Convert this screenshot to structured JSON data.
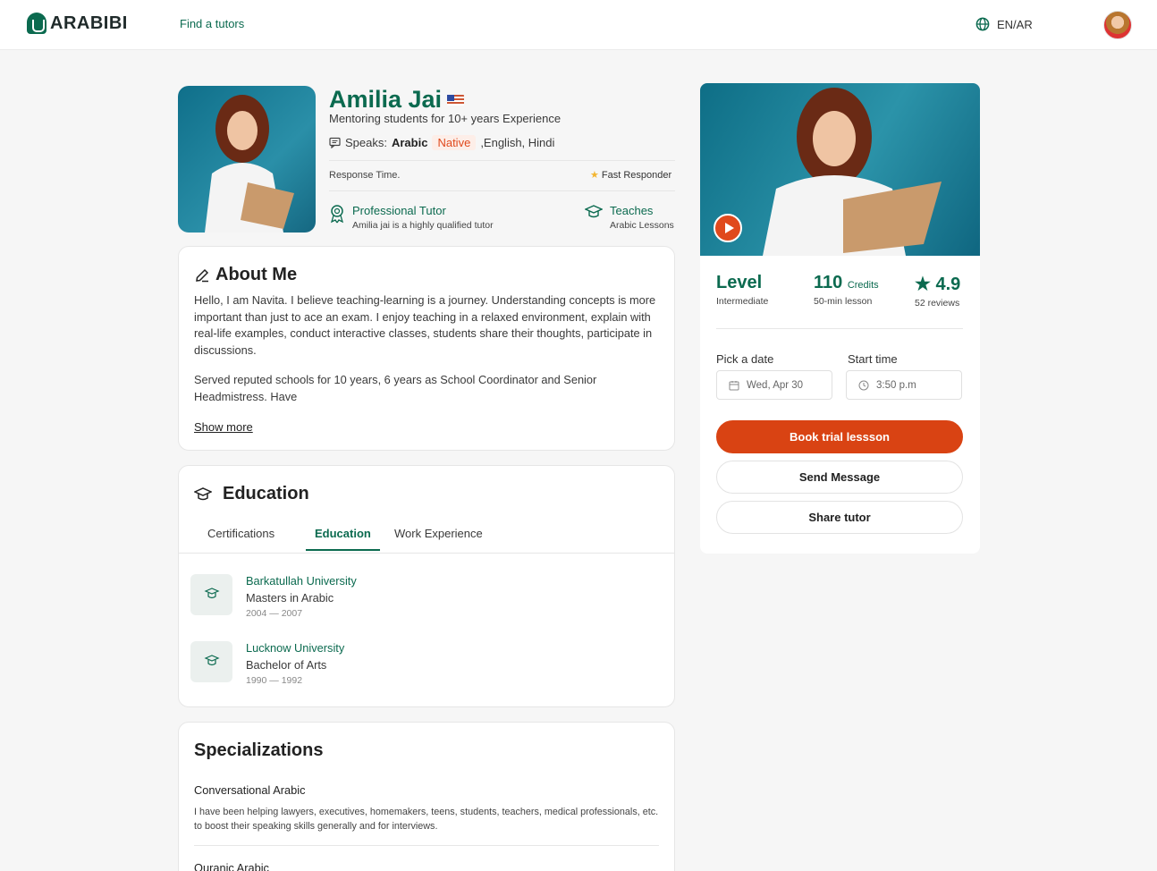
{
  "header": {
    "logo_text": "ARABIBI",
    "nav_link": "Find a tutors",
    "language": "EN/AR"
  },
  "profile": {
    "name": "Amilia Jai",
    "subtitle": "Mentoring students for 10+  years Experience",
    "speaks_label": "Speaks:",
    "speaks_primary": "Arabic",
    "native_badge": "Native",
    "speaks_others": ",English, Hindi",
    "response_label": "Response Time.",
    "fast_responder": "Fast Responder",
    "features": [
      {
        "title": "Professional Tutor",
        "desc": "Amilia jai is a highly qualified tutor"
      },
      {
        "title": "Teaches",
        "desc": "Arabic Lessons"
      }
    ]
  },
  "about": {
    "title": "About Me",
    "p1": "Hello, I am Navita. I believe teaching-learning is a journey. Understanding concepts is more important than just to ace an exam. I enjoy teaching in a relaxed environment, explain with real-life examples, conduct interactive classes, students share their thoughts, participate in discussions.",
    "p2": "Served reputed schools for 10 years, 6 years as School Coordinator and Senior Headmistress. Have",
    "show_more": "Show more"
  },
  "education": {
    "title": "Education",
    "tabs": [
      "Certifications",
      "Education",
      "Work Experience"
    ],
    "active_tab": "Education",
    "items": [
      {
        "university": "Barkatullah University",
        "degree": "Masters in Arabic",
        "years": "2004 — 2007"
      },
      {
        "university": "Lucknow University",
        "degree": "Bachelor of Arts",
        "years": "1990 — 1992"
      }
    ]
  },
  "specializations": {
    "title": "Specializations",
    "items": [
      {
        "title": "Conversational Arabic",
        "desc": "I have been helping lawyers, executives, homemakers, teens, students, teachers, medical professionals, etc. to boost their speaking skills generally and for interviews."
      },
      {
        "title": "Quranic Arabic",
        "desc": ""
      }
    ]
  },
  "booking": {
    "level_label": "Level",
    "level_value": "Intermediate",
    "credits_value": "110",
    "credits_unit": "Credits",
    "credits_desc": "50-min lesson",
    "rating": "4.9",
    "reviews": "52 reviews",
    "date_label": "Pick a date",
    "date_value": "Wed, Apr 30",
    "time_label": "Start time",
    "time_value": "3:50 p.m",
    "book_button": "Book trial lessson",
    "message_button": "Send Message",
    "share_button": "Share tutor"
  },
  "colors": {
    "brand_green": "#0b6a4f",
    "accent_orange": "#d94313",
    "native_badge_bg": "#fdeee8"
  }
}
